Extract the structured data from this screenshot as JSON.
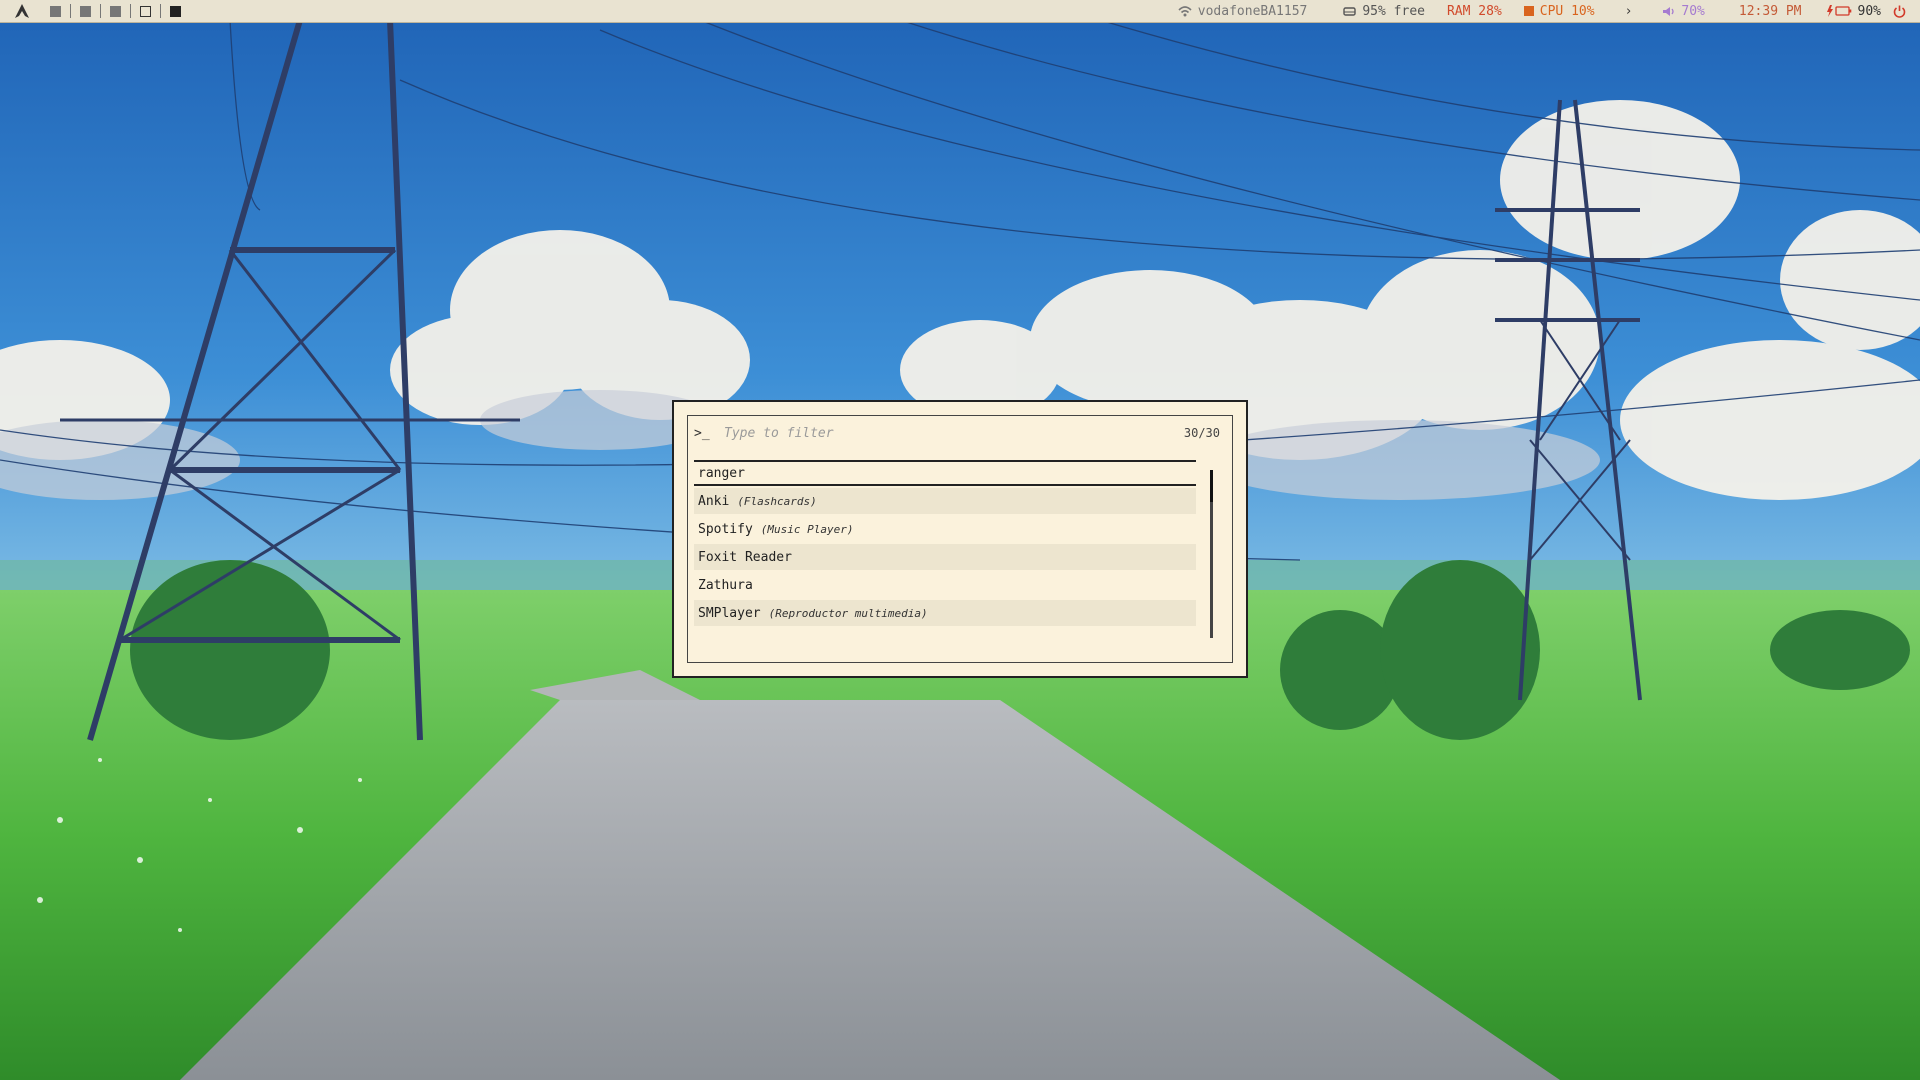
{
  "topbar": {
    "logo_icon": "arch-logo-icon",
    "workspaces": [
      {
        "state": "occupied"
      },
      {
        "state": "occupied"
      },
      {
        "state": "occupied"
      },
      {
        "state": "empty"
      },
      {
        "state": "focused"
      }
    ],
    "wifi": {
      "icon": "wifi-icon",
      "label": "vodafoneBA1157"
    },
    "disk": {
      "icon": "disk-icon",
      "label": "95% free"
    },
    "ram": {
      "label": "RAM 28%",
      "color": "#d14a2b"
    },
    "cpu": {
      "icon": "cpu-icon",
      "label": "CPU 10%",
      "color": "#d9641e"
    },
    "expand": {
      "label": "›"
    },
    "volume": {
      "icon": "volume-icon",
      "label": "70%",
      "color": "#a57bd0"
    },
    "clock": {
      "label": "12:39 PM",
      "color": "#c45a36"
    },
    "battery": {
      "icon": "battery-charging-icon",
      "label": "90%",
      "color": "#d23a2a"
    },
    "power": {
      "icon": "power-icon",
      "color": "#d23a2a"
    }
  },
  "launcher": {
    "prompt": ">_",
    "placeholder": "Type to filter",
    "count": "30/30",
    "items": [
      {
        "name": "ranger",
        "desc": ""
      },
      {
        "name": "Anki",
        "desc": "(Flashcards)"
      },
      {
        "name": "Spotify",
        "desc": "(Music Player)"
      },
      {
        "name": "Foxit Reader",
        "desc": ""
      },
      {
        "name": "Zathura",
        "desc": ""
      },
      {
        "name": "SMPlayer",
        "desc": "(Reproductor multimedia)"
      }
    ]
  },
  "colors": {
    "launcher_bg": "#fbf2dc",
    "launcher_alt_row": "#ede5cf",
    "bar_bg": "#e9e3d1",
    "accent": "#d14a2b"
  }
}
